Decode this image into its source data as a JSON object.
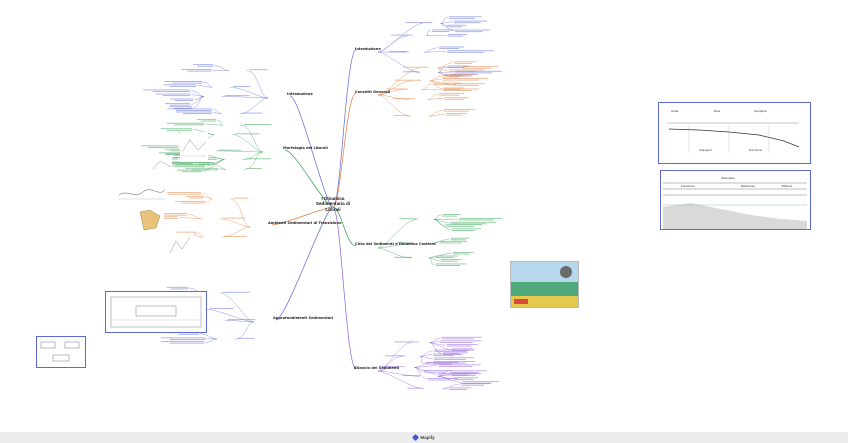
{
  "central_topic": "I Dinamica Sedimentaria di Litorali",
  "branches": [
    {
      "name": "left-1",
      "color": "#5b6ad8",
      "label": "Introduzione"
    },
    {
      "name": "left-2",
      "color": "#2e9e4f",
      "label": "Morfologia dei Litorali"
    },
    {
      "name": "left-3",
      "color": "#e07b39",
      "label": "Ambienti Sedimentari di Transizione"
    },
    {
      "name": "left-4",
      "color": "#5b6ad8",
      "label": "Approfondimenti Sedimentari"
    },
    {
      "name": "right-1",
      "color": "#5b6ad8",
      "label": "Introduzione"
    },
    {
      "name": "right-2",
      "color": "#e07b39",
      "label": "Concetti Generali"
    },
    {
      "name": "right-3",
      "color": "#2e9e4f",
      "label": "Ciclo dei Sedimenti e Dinamica Costiera"
    },
    {
      "name": "right-4",
      "color": "#8e5bd8",
      "label": "Bilancio dei Sedimenti"
    }
  ],
  "diagram_labels": {
    "profile_top": [
      "Onde",
      "Riva",
      "Scogliera",
      "Frangenti",
      "Surf Zone"
    ],
    "profile_bottom": [
      "Shoreface",
      "Foreshore",
      "Backshore",
      "Offshore"
    ]
  },
  "brand": {
    "name": "Mapify"
  }
}
